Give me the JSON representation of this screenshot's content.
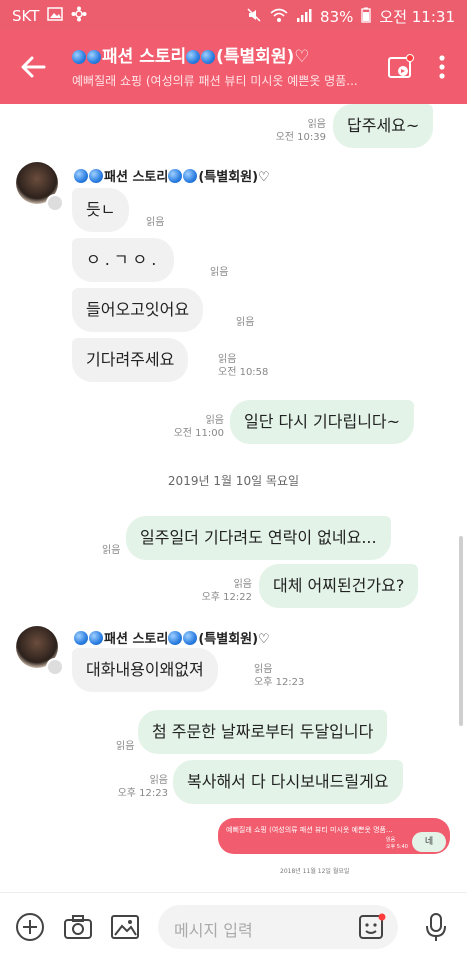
{
  "status": {
    "carrier": "SKT",
    "battery": "83%",
    "time": "오전 11:31"
  },
  "header": {
    "title": "패션 스토리",
    "title_suffix": "(특별회원)♡",
    "subtitle": "예뻐질래 쇼핑 (여성의류 패션 뷰티 미시옷 예쁜옷 명품..."
  },
  "sender": {
    "name": "패션 스토리",
    "suffix": "(특별회원)♡"
  },
  "messages": {
    "m0": {
      "text": "답주세요~",
      "read": "읽음",
      "time": "오전 10:39"
    },
    "m1": {
      "text": "듯ㄴ",
      "read": "읽음"
    },
    "m2": {
      "text": "ㅇ.ㄱㅇ.",
      "read": "읽음"
    },
    "m3": {
      "text": "들어오고잇어요",
      "read": "읽음"
    },
    "m4": {
      "text": "기다려주세요",
      "read": "읽음",
      "time": "오전 10:58"
    },
    "m5": {
      "text": "일단 다시 기다립니다~",
      "read": "읽음",
      "time": "오전 11:00"
    },
    "date": "2019년 1월 10일 목요일",
    "m6": {
      "text": "일주일더 기다려도 연락이 없네요...",
      "read": "읽음"
    },
    "m7": {
      "text": "대체 어찌된건가요?",
      "read": "읽음",
      "time": "오후 12:22"
    },
    "m8": {
      "text": "대화내용이왜없져",
      "read": "읽음",
      "time": "오후 12:23"
    },
    "m9": {
      "text": "첨 주문한 날짜로부터 두달입니다",
      "read": "읽음"
    },
    "m10": {
      "text": "복사해서 다 다시보내드릴게요",
      "read": "읽음",
      "time": "오후 12:23"
    }
  },
  "preview": {
    "header_text": "예뻐질래 쇼핑 (여성의류 패션 뷰티 미시옷 예쁜옷 명품...",
    "bubble": "네",
    "read": "읽음",
    "time": "오후 5:40",
    "date": "2018년 11월 12일 월요일"
  },
  "input": {
    "placeholder": "메시지 입력"
  }
}
